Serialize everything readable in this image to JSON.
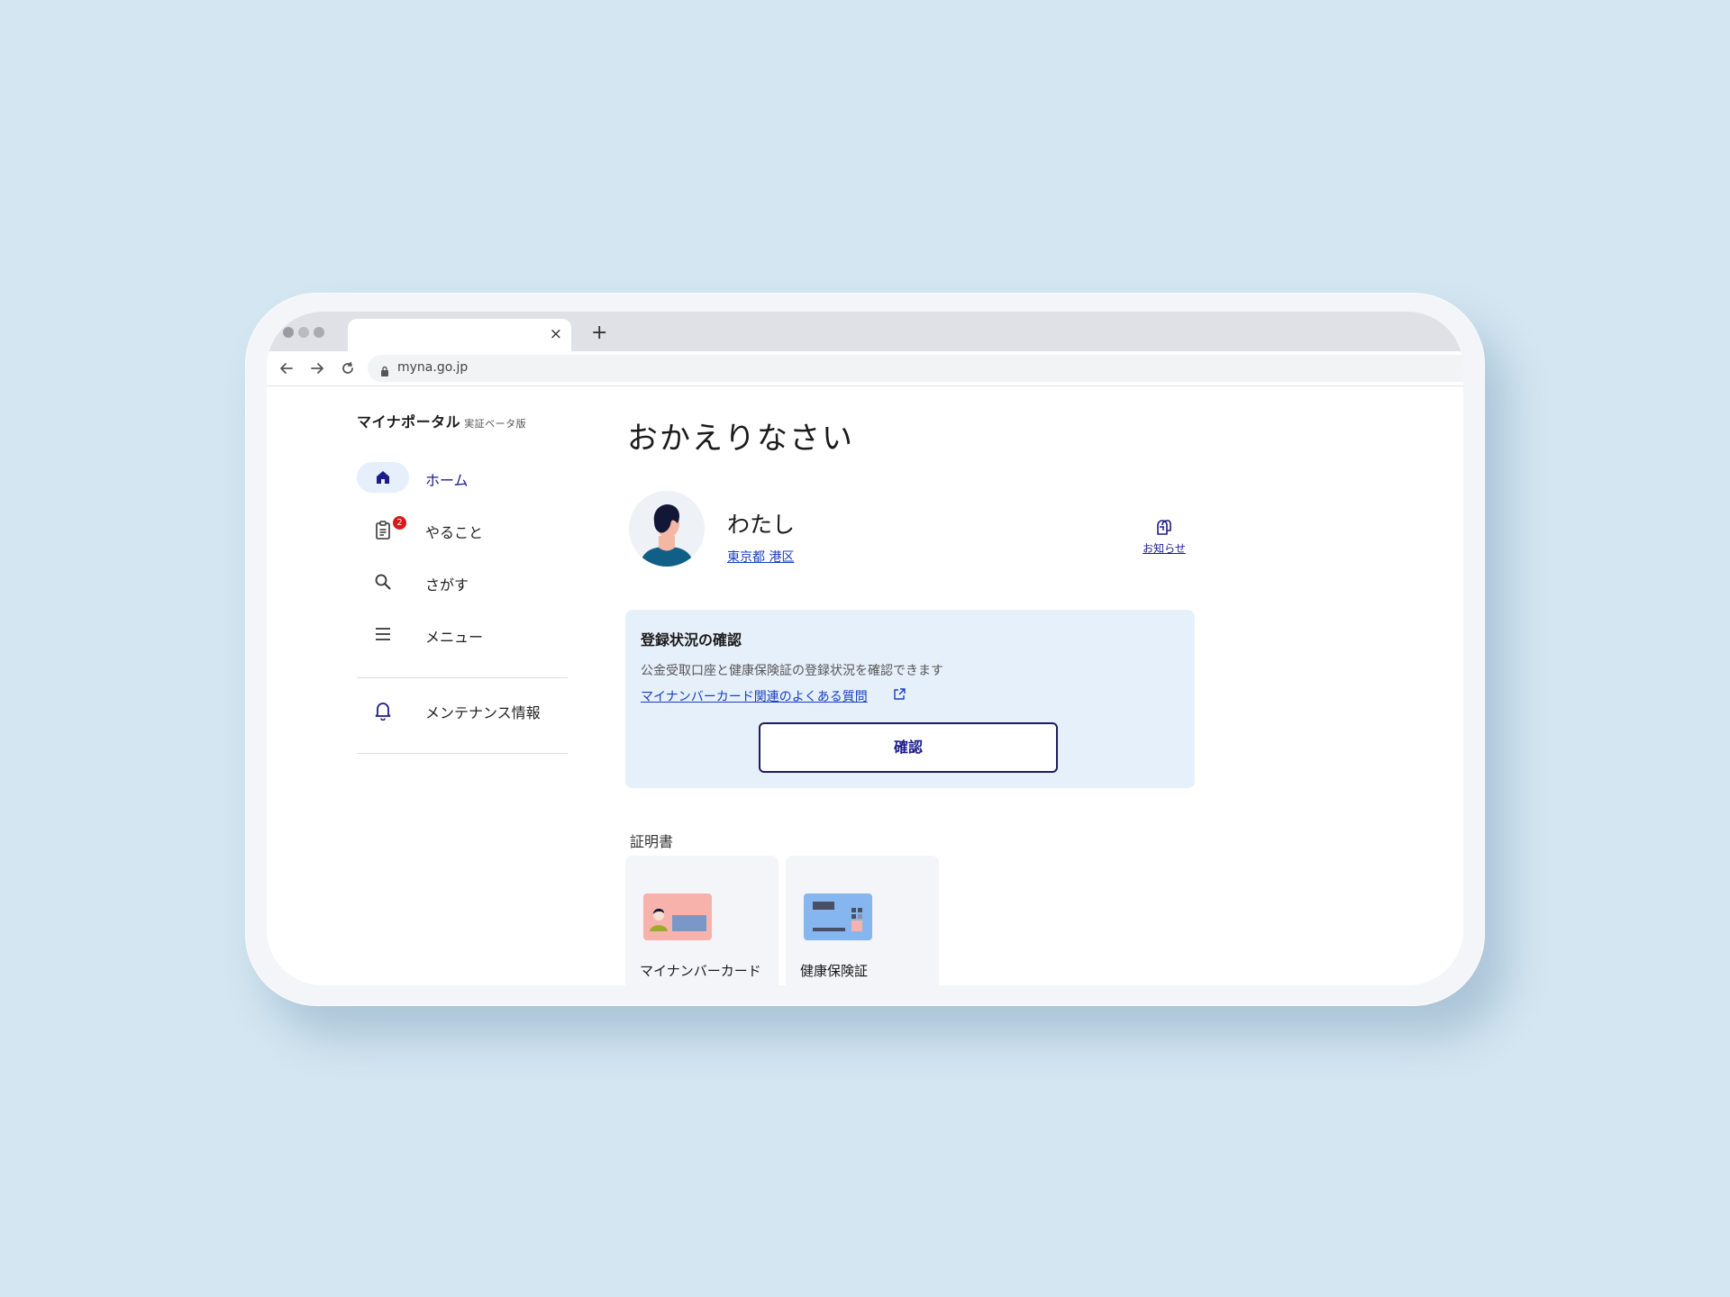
{
  "browser": {
    "tab_close": "×",
    "new_tab": "+",
    "url": "myna.go.jp"
  },
  "brand": {
    "name": "マイナポータル",
    "sub": "実証ベータ版"
  },
  "sidebar": {
    "items": [
      {
        "label": "ホーム",
        "icon": "home-icon",
        "active": true
      },
      {
        "label": "やること",
        "icon": "clipboard-icon",
        "badge": "2"
      },
      {
        "label": "さがす",
        "icon": "search-icon"
      },
      {
        "label": "メニュー",
        "icon": "menu-icon"
      },
      {
        "label": "メンテナンス情報",
        "icon": "bell-icon"
      }
    ]
  },
  "main": {
    "greeting": "おかえりなさい",
    "user": {
      "name": "わたし",
      "location": "東京都 港区"
    },
    "notice_label": "お知らせ",
    "registration_card": {
      "title": "登録状況の確認",
      "description": "公金受取口座と健康保険証の登録状況を確認できます",
      "link": "マイナンバーカード関連のよくある質問",
      "button": "確認"
    },
    "certificates": {
      "title": "証明書",
      "items": [
        {
          "label": "マイナンバーカード"
        },
        {
          "label": "健康保険証"
        }
      ]
    }
  },
  "colors": {
    "background": "#d3e6f1",
    "accent": "#1c1c8a",
    "link": "#1a3dbf",
    "card_bg": "#e6f0fb",
    "badge": "#d7191c"
  }
}
